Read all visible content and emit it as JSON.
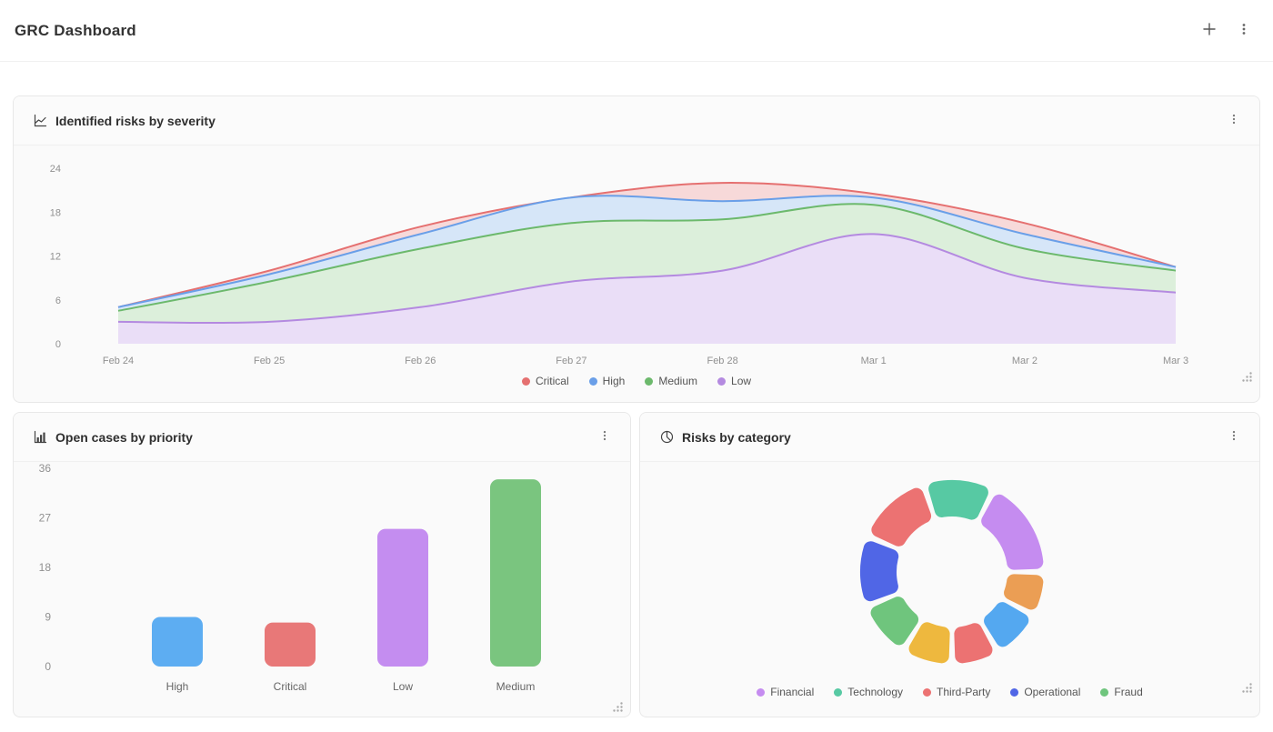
{
  "page": {
    "title": "GRC Dashboard"
  },
  "toolbar": {
    "add_icon": "plus-icon",
    "menu_icon": "kebab-vertical-icon"
  },
  "cards": {
    "severity": {
      "title": "Identified risks by severity",
      "icon": "line-chart-icon"
    },
    "priority": {
      "title": "Open cases by priority",
      "icon": "bar-chart-icon"
    },
    "category": {
      "title": "Risks by category",
      "icon": "pie-chart-icon"
    }
  },
  "chart_data": [
    {
      "id": "severity_area",
      "type": "area",
      "title": "Identified risks by severity",
      "x": [
        "Feb 24",
        "Feb 25",
        "Feb 26",
        "Feb 27",
        "Feb 28",
        "Mar 1",
        "Mar 2",
        "Mar 3"
      ],
      "yticks": [
        0,
        6,
        12,
        18,
        24
      ],
      "ylim": [
        0,
        24
      ],
      "grid": false,
      "legend_position": "bottom",
      "series": [
        {
          "name": "Critical",
          "color": "#e57070",
          "fill": "#f7d9d9",
          "values": [
            5,
            10,
            16,
            20,
            22,
            20.5,
            16.5,
            10.5
          ]
        },
        {
          "name": "High",
          "color": "#6a9fe8",
          "fill": "#d6e6f8",
          "values": [
            5,
            9.5,
            15,
            20,
            19.5,
            20,
            15,
            10.5
          ]
        },
        {
          "name": "Medium",
          "color": "#6cb96c",
          "fill": "#dcefdb",
          "values": [
            4.5,
            8.5,
            13,
            16.5,
            17,
            19,
            13,
            10
          ]
        },
        {
          "name": "Low",
          "color": "#b48ae0",
          "fill": "#eadef7",
          "values": [
            3,
            3,
            5,
            8.5,
            10,
            15,
            9,
            7
          ]
        }
      ]
    },
    {
      "id": "priority_bar",
      "type": "bar",
      "title": "Open cases by priority",
      "categories": [
        "High",
        "Critical",
        "Low",
        "Medium"
      ],
      "values": [
        9,
        8,
        25,
        34
      ],
      "colors": [
        "#5dadf2",
        "#e87878",
        "#c48df0",
        "#7ac57f"
      ],
      "yticks": [
        0,
        9,
        18,
        27,
        36
      ],
      "ylim": [
        0,
        36
      ],
      "grid": false
    },
    {
      "id": "category_donut",
      "type": "donut",
      "title": "Risks by category",
      "legend_position": "bottom",
      "legend": [
        {
          "label": "Financial",
          "color": "#c58cf0"
        },
        {
          "label": "Technology",
          "color": "#57c9a3"
        },
        {
          "label": "Third-Party",
          "color": "#ec7272"
        },
        {
          "label": "Operational",
          "color": "#5066e6"
        },
        {
          "label": "Fraud",
          "color": "#6fc57d"
        }
      ],
      "segments": [
        {
          "color": "#57c9a3",
          "start_deg": -18,
          "end_deg": 27,
          "legend": "Technology"
        },
        {
          "color": "#c58cf0",
          "start_deg": 27,
          "end_deg": 90,
          "legend": "Financial"
        },
        {
          "color": "#eb9e54",
          "start_deg": 90,
          "end_deg": 118,
          "legend": ""
        },
        {
          "color": "#54a8f0",
          "start_deg": 118,
          "end_deg": 150,
          "legend": ""
        },
        {
          "color": "#ec7272",
          "start_deg": 150,
          "end_deg": 180,
          "legend": "Third-Party"
        },
        {
          "color": "#eeb83e",
          "start_deg": 180,
          "end_deg": 212,
          "legend": ""
        },
        {
          "color": "#6fc57d",
          "start_deg": 212,
          "end_deg": 248,
          "legend": "Fraud"
        },
        {
          "color": "#5066e6",
          "start_deg": 248,
          "end_deg": 293,
          "legend": "Operational"
        },
        {
          "color": "#ec7272",
          "start_deg": 293,
          "end_deg": 342,
          "legend": "Third-Party"
        }
      ]
    }
  ]
}
